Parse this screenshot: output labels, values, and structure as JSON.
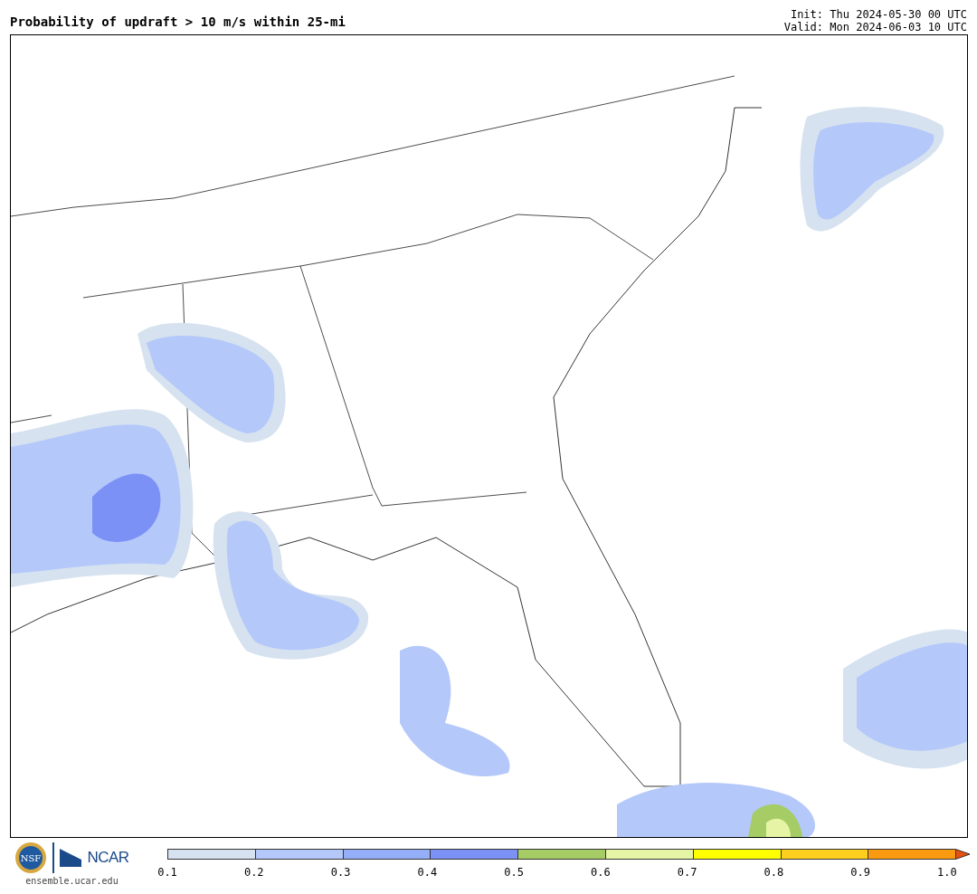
{
  "title": "Probability of updraft > 10 m/s within 25-mi",
  "init": "Init: Thu 2024-05-30 00 UTC",
  "valid": "Valid: Mon 2024-06-03 10 UTC",
  "logos": {
    "nsf": "NSF",
    "ncar": "NCAR",
    "site": "ensemble.ucar.edu"
  },
  "colorbar": {
    "segments": [
      {
        "kind": "band",
        "color": "#d6e2ef"
      },
      {
        "kind": "band",
        "color": "#b4c8fa"
      },
      {
        "kind": "band",
        "color": "#94aef8"
      },
      {
        "kind": "band",
        "color": "#7b91f5"
      },
      {
        "kind": "band",
        "color": "#a5cc65"
      },
      {
        "kind": "band",
        "color": "#e5f5a5"
      },
      {
        "kind": "band",
        "color": "#ffff00"
      },
      {
        "kind": "band",
        "color": "#ffcf20"
      },
      {
        "kind": "band",
        "color": "#fa9a10"
      },
      {
        "kind": "extend",
        "color": "#e85010"
      }
    ],
    "ticks": [
      "0.1",
      "0.2",
      "0.3",
      "0.4",
      "0.5",
      "0.6",
      "0.7",
      "0.8",
      "0.9",
      "1.0"
    ]
  }
}
